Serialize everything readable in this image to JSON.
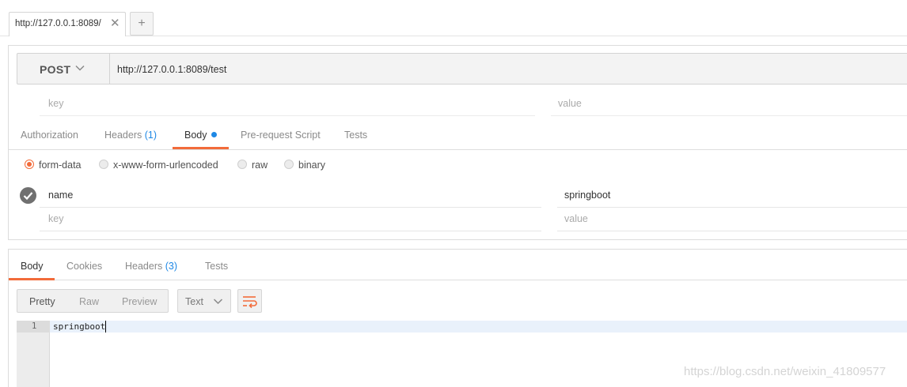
{
  "tabs": [
    {
      "title": "http://127.0.0.1:8089/",
      "close": "✕"
    }
  ],
  "new_tab_symbol": "+",
  "request": {
    "method": "POST",
    "url": "http://127.0.0.1:8089/test",
    "params": {
      "key_placeholder": "key",
      "value_placeholder": "value"
    },
    "tabs": [
      {
        "label": "Authorization"
      },
      {
        "label": "Headers",
        "count": "(1)"
      },
      {
        "label": "Body",
        "active": true
      },
      {
        "label": "Pre-request Script"
      },
      {
        "label": "Tests"
      }
    ],
    "body_modes": [
      {
        "label": "form-data",
        "selected": true
      },
      {
        "label": "x-www-form-urlencoded"
      },
      {
        "label": "raw"
      },
      {
        "label": "binary"
      }
    ],
    "form_rows": [
      {
        "key": "name",
        "value": "springboot",
        "enabled": true
      }
    ],
    "new_row": {
      "key_placeholder": "key",
      "value_placeholder": "value"
    }
  },
  "response": {
    "tabs": [
      {
        "label": "Body",
        "active": true
      },
      {
        "label": "Cookies"
      },
      {
        "label": "Headers",
        "count": "(3)"
      },
      {
        "label": "Tests"
      }
    ],
    "formats": [
      {
        "label": "Pretty",
        "active": true
      },
      {
        "label": "Raw"
      },
      {
        "label": "Preview"
      }
    ],
    "language": "Text",
    "lines": [
      {
        "number": "1",
        "text": "springboot"
      }
    ]
  },
  "watermark": "https://blog.csdn.net/weixin_41809577",
  "colors": {
    "accent": "#f26b3a",
    "count_blue": "#1e88e5"
  }
}
